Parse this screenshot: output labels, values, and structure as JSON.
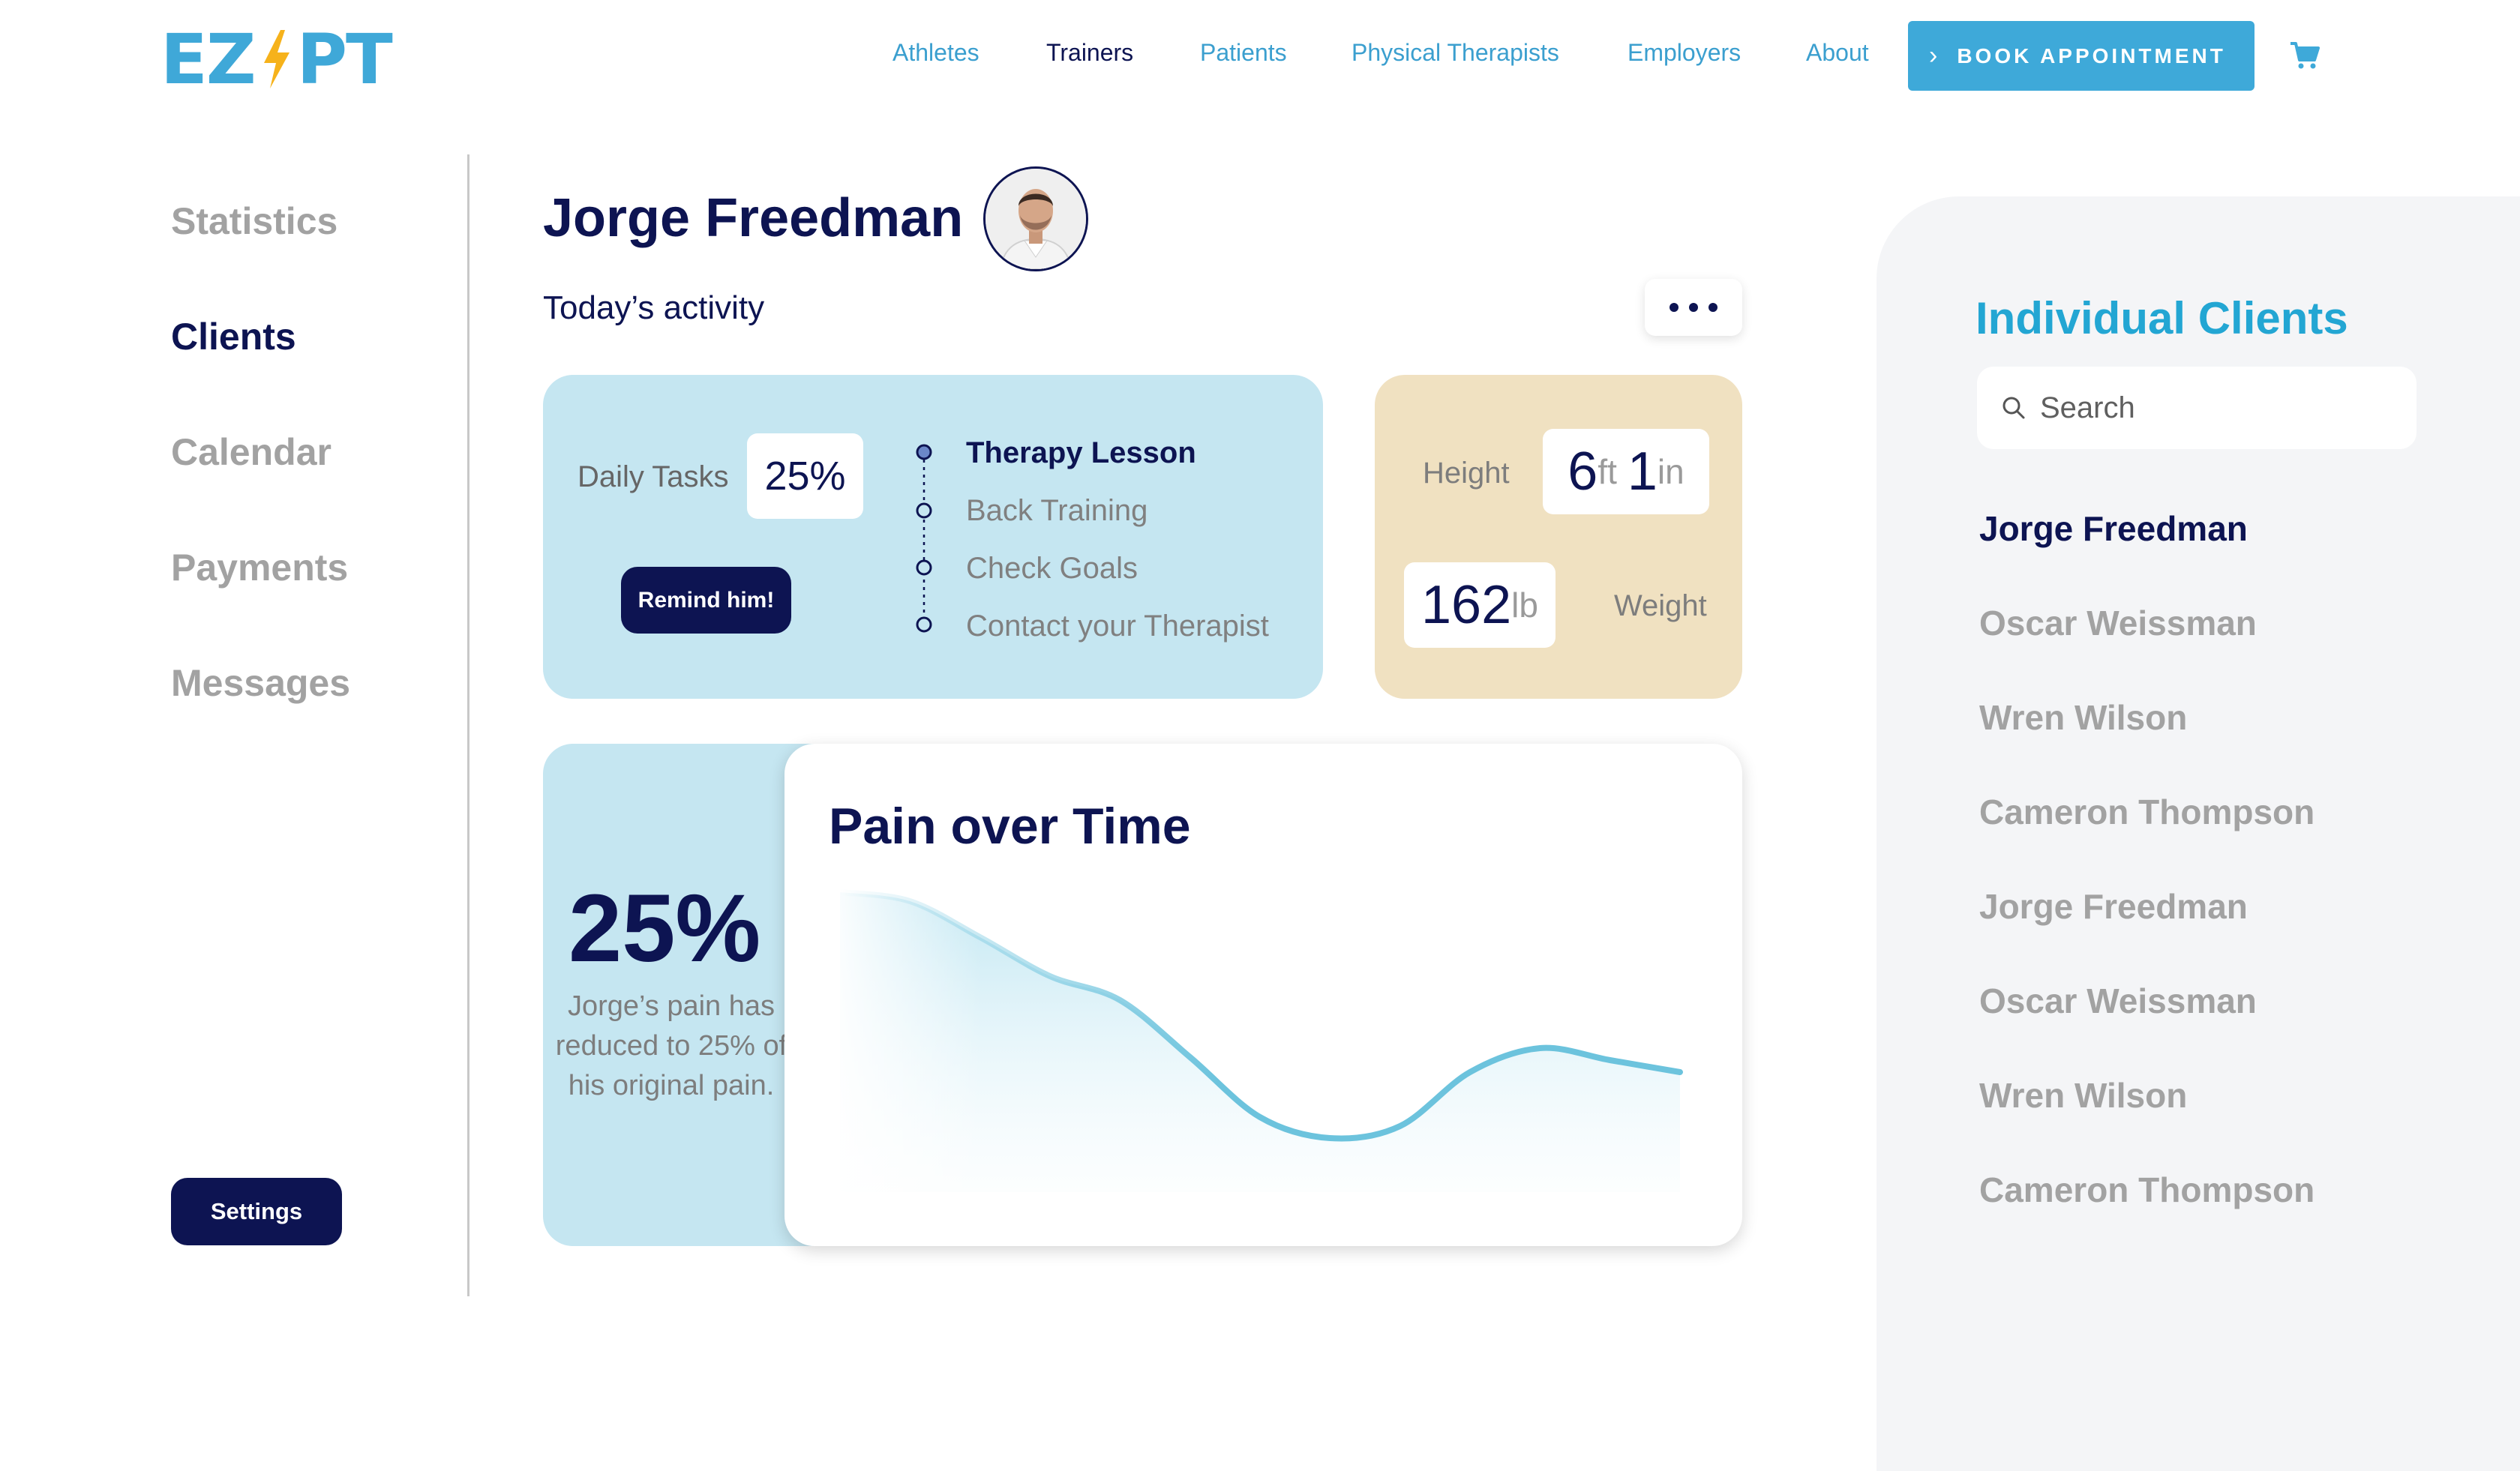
{
  "brand": {
    "logo_text": [
      "EZ",
      "PT"
    ],
    "accent": "#3ea9d9",
    "navy": "#0d1452"
  },
  "nav": {
    "links": [
      "Athletes",
      "Trainers",
      "Patients",
      "Physical Therapists",
      "Employers",
      "About"
    ],
    "active": "Trainers",
    "book_label": "BOOK APPOINTMENT",
    "cart_icon": "cart-icon"
  },
  "sidebar": {
    "items": [
      "Statistics",
      "Clients",
      "Calendar",
      "Payments",
      "Messages"
    ],
    "active": "Clients",
    "settings_label": "Settings"
  },
  "profile": {
    "name": "Jorge Freedman",
    "subtitle": "Today’s activity"
  },
  "activity": {
    "daily_label": "Daily Tasks",
    "daily_value": "25%",
    "remind_label": "Remind him!",
    "tasks": [
      "Therapy Lesson",
      "Back Training",
      "Check Goals",
      "Contact your Therapist"
    ]
  },
  "body_stats": {
    "height_label": "Height",
    "height_ft": "6",
    "height_ft_unit": "ft",
    "height_in": "1",
    "height_in_unit": "in",
    "weight_value": "162",
    "weight_unit": "lb",
    "weight_label": "Weight"
  },
  "pain": {
    "percent": "25%",
    "description": "Jorge’s pain has reduced to 25% of his original pain.",
    "chart_title": "Pain over Time"
  },
  "chart_data": {
    "type": "area",
    "title": "Pain over Time",
    "x": [
      0,
      1,
      2,
      3,
      4,
      5,
      6,
      7,
      8,
      9,
      10,
      11,
      12
    ],
    "values": [
      100,
      97,
      85,
      72,
      64,
      45,
      25,
      18,
      22,
      40,
      48,
      44,
      40
    ],
    "ylim": [
      0,
      110
    ],
    "grid": false,
    "color": "#6cc3dd"
  },
  "clients_panel": {
    "title": "Individual Clients",
    "search_placeholder": "Search",
    "clients": [
      "Jorge Freedman",
      "Oscar Weissman",
      "Wren Wilson",
      "Cameron Thompson",
      "Jorge Freedman",
      "Oscar Weissman",
      "Wren Wilson",
      "Cameron Thompson"
    ],
    "active_index": 0
  }
}
